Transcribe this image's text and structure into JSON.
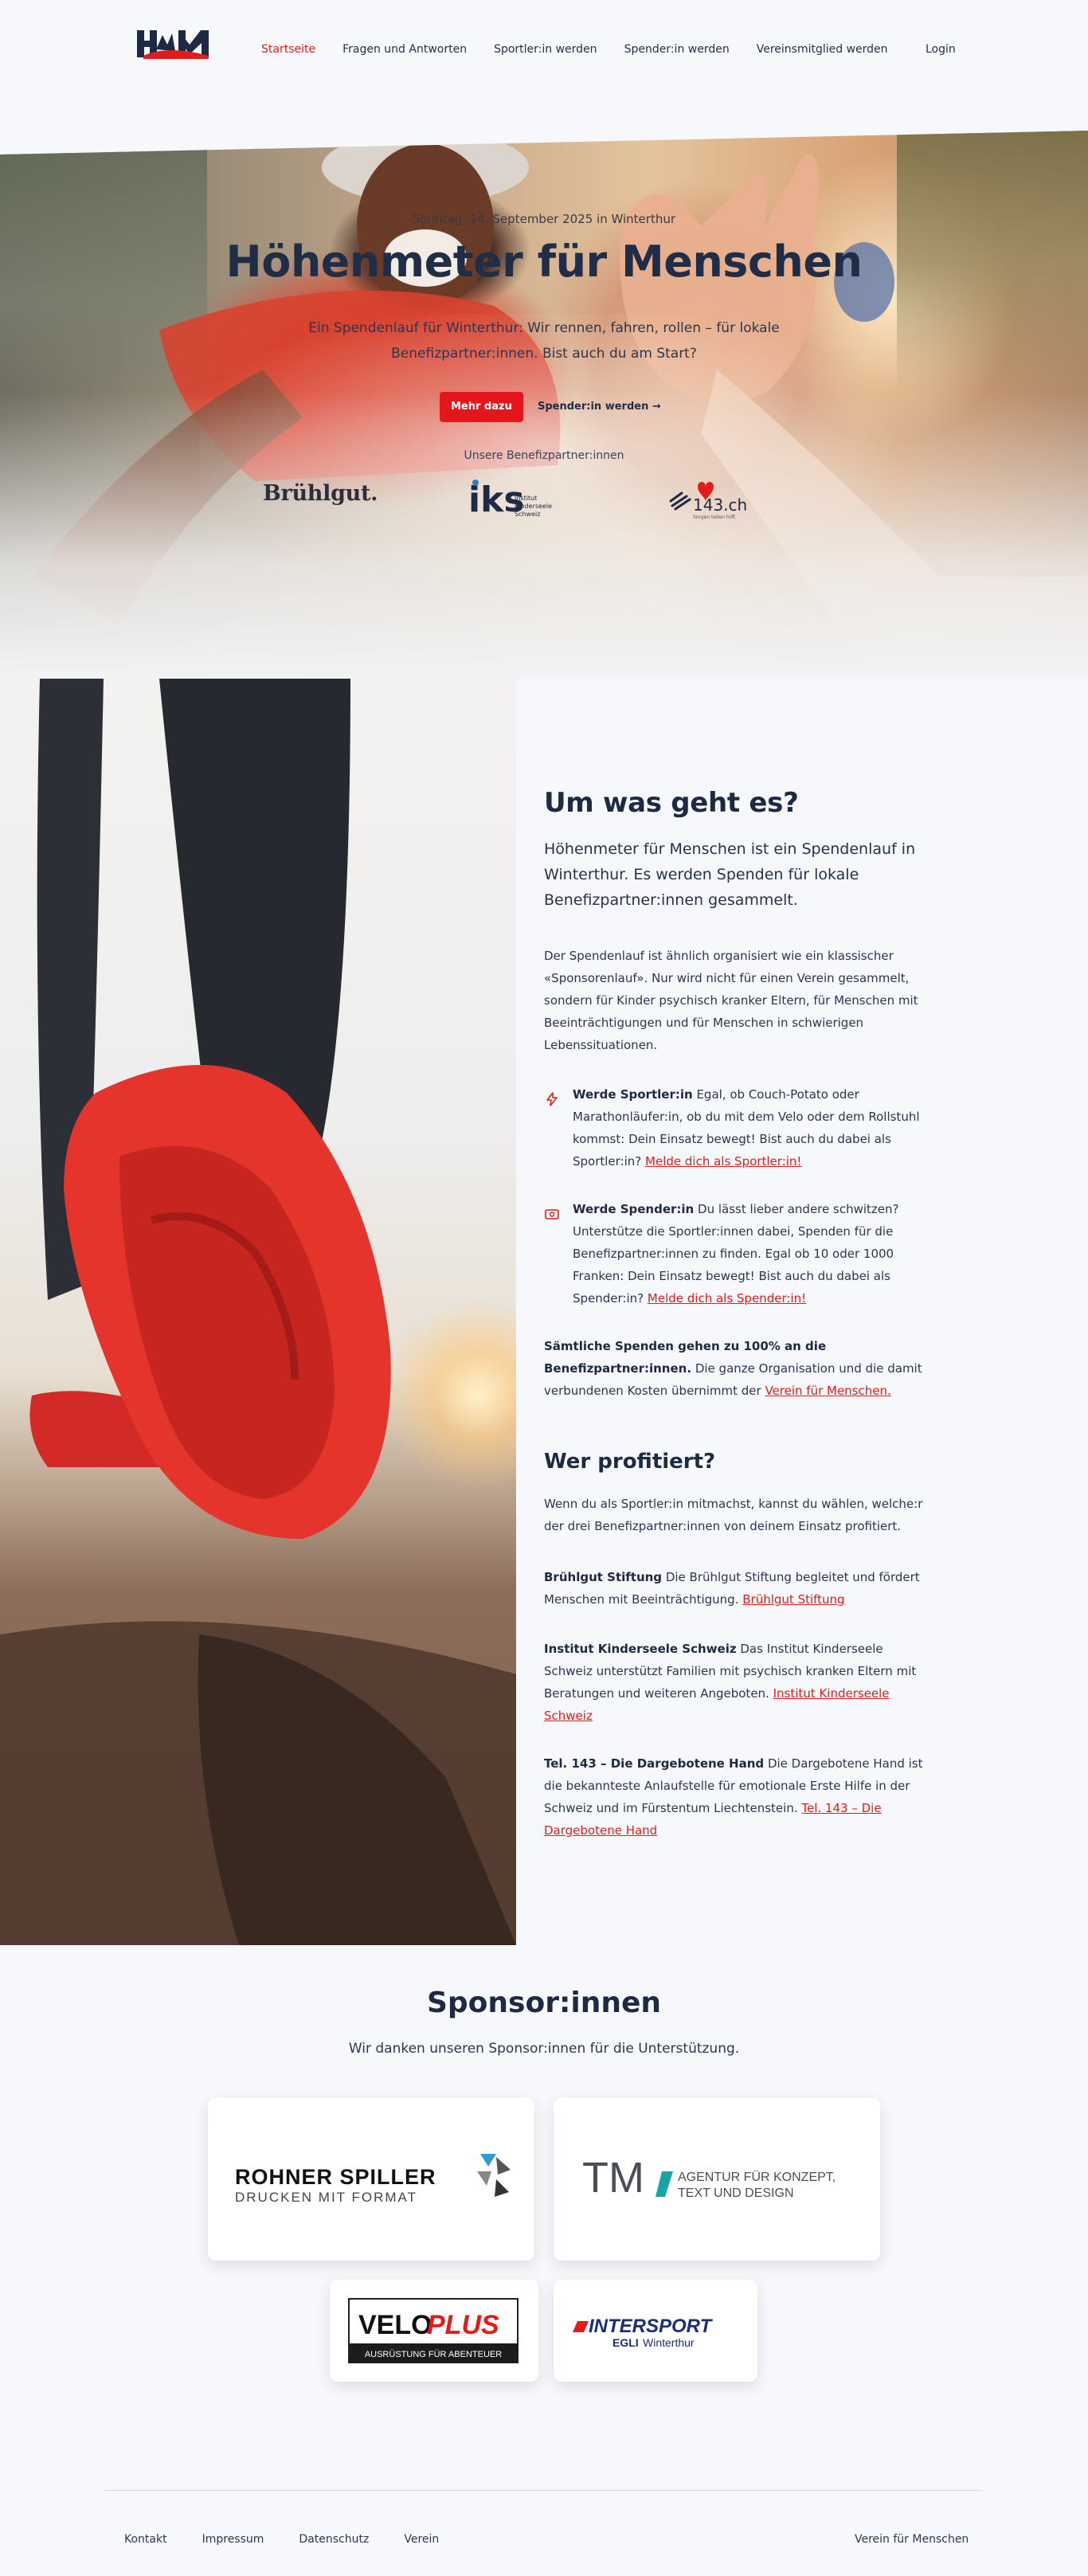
{
  "brand": {
    "logo_text": "HfM",
    "accent": "#e21b1b",
    "navy": "#1d2a44"
  },
  "nav": {
    "items": [
      {
        "label": "Startseite",
        "active": true
      },
      {
        "label": "Fragen und Antworten",
        "active": false
      },
      {
        "label": "Sportler:in werden",
        "active": false
      },
      {
        "label": "Spender:in werden",
        "active": false
      },
      {
        "label": "Vereinsmitglied werden",
        "active": false
      }
    ],
    "login": "Login"
  },
  "hero": {
    "kicker": "Sonntag, 14. September 2025 in Winterthur",
    "title": "Höhenmeter für Menschen",
    "lead": "Ein Spendenlauf für Winterthur: Wir rennen, fahren, rollen – für lokale Benefizpartner:innen. Bist auch du am Start?",
    "cta_primary": "Mehr dazu",
    "cta_secondary": "Spender:in werden →",
    "partners_label": "Unsere Benefizpartner:innen",
    "partners": {
      "bruehlgut": "Brühlgut.",
      "iks_mark": "iks",
      "iks_text": [
        "Institut",
        "Kinderseele",
        "Schweiz"
      ],
      "tel143": "143.ch",
      "tel143_sub": "Sorgen teilen hilft"
    }
  },
  "about": {
    "title": "Um was geht es?",
    "lead": "Höhenmeter für Menschen ist ein Spendenlauf in Winterthur. Es werden Spenden für lokale Benefizpartner:innen gesammelt.",
    "intro": "Der Spendenlauf ist ähnlich organisiert wie ein klassischer «Sponsorenlauf». Nur wird nicht für einen Verein gesammelt, sondern für Kinder psychisch kranker Eltern, für Menschen mit Beeinträchtigungen und für Menschen in schwierigen Lebenssituationen.",
    "athlete": {
      "heading": "Werde Sportler:in",
      "text": "Egal, ob Couch-Potato oder Marathonläufer:in, ob du mit dem Velo oder dem Rollstuhl kommst: Dein Einsatz bewegt! Bist auch du dabei als Sportler:in?",
      "link": "Melde dich als Sportler:in!"
    },
    "donor": {
      "heading": "Werde Spender:in",
      "text": "Du lässt lieber andere schwitzen? Unterstütze die Sportler:innen dabei, Spenden für die Benefizpartner:innen zu finden. Egal ob 10 oder 1000 Franken: Dein Einsatz bewegt! Bist auch du dabei als Spender:in?",
      "link": "Melde dich als Spender:in!"
    },
    "all_heading": "Sämtliche Spenden gehen zu 100% an die Benefizpartner:innen.",
    "all_text": "Die ganze Organisation und die damit verbundenen Kosten übernimmt der",
    "all_link": "Verein für Menschen."
  },
  "beneficiaries": {
    "title": "Wer profitiert?",
    "intro": "Wenn du als Sportler:in mitmachst, kannst du wählen, welche:r der drei Benefizpartner:innen von deinem Einsatz profitiert.",
    "items": [
      {
        "name": "Brühlgut Stiftung",
        "text": "Die Brühlgut Stiftung begleitet und fördert Menschen mit Beeinträchtigung.",
        "link": "Brühlgut Stiftung"
      },
      {
        "name": "Institut Kinderseele Schweiz",
        "text": "Das Institut Kinderseele Schweiz unterstützt Familien mit psychisch kranken Eltern mit Beratungen und weiteren Angeboten.",
        "link": "Institut Kinderseele Schweiz"
      },
      {
        "name": "Tel. 143 – Die Dargebotene Hand",
        "text": "Die Dargebotene Hand ist die bekannteste Anlaufstelle für emotionale Erste Hilfe in der Schweiz und im Fürstentum Liechtenstein.",
        "link": "Tel. 143 – Die Dargebotene Hand"
      }
    ]
  },
  "sponsors": {
    "title": "Sponsor:innen",
    "subtitle": "Wir danken unseren Sponsor:innen für die Unterstützung.",
    "rohner": {
      "line1": "ROHNER SPILLER",
      "line2": "DRUCKEN MIT FORMAT"
    },
    "tm": {
      "mark": "TM",
      "line1": "AGENTUR FÜR KONZEPT,",
      "line2": "TEXT UND DESIGN"
    },
    "veloplus": {
      "word1": "VELO",
      "word2": "PLUS",
      "tagline": "AUSRÜSTUNG FÜR ABENTEUER"
    },
    "intersport": {
      "word": "INTERSPORT",
      "sub1": "EGLI",
      "sub2": "Winterthur"
    }
  },
  "footer": {
    "links": [
      "Kontakt",
      "Impressum",
      "Datenschutz",
      "Verein"
    ],
    "right": "Verein für Menschen"
  }
}
